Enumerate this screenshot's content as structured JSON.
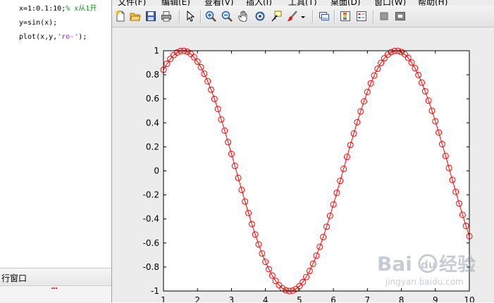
{
  "editor": {
    "lines": [
      {
        "code": "x=1:0.1:10;",
        "comment": "%  x从1开"
      },
      {
        "code": "y=sin(x);"
      },
      {
        "code_pre": "plot(x,y,",
        "string": "'ro-'",
        "code_post": ");"
      }
    ]
  },
  "command_window": {
    "title": "行窗口"
  },
  "figure": {
    "menu": [
      "文件(F)",
      "编辑(E)",
      "查看(V)",
      "插入(I)",
      "工具(T)",
      "桌面(D)",
      "窗口(W)",
      "帮助(H)"
    ],
    "toolbar": [
      "new-figure-icon",
      "open-icon",
      "save-icon",
      "print-icon",
      "select-arrow-icon",
      "zoom-in-icon",
      "zoom-out-icon",
      "pan-hand-icon",
      "rotate-3d-icon",
      "data-cursor-icon",
      "brush-icon",
      "brush-dropdown-icon",
      "link-plot-icon",
      "colorbar-icon",
      "legend-icon",
      "hide-plot-tools-icon",
      "show-plot-tools-icon"
    ]
  },
  "chart_data": {
    "type": "line",
    "title": "",
    "xlabel": "",
    "ylabel": "",
    "xlim": [
      1,
      10
    ],
    "ylim": [
      -1,
      1
    ],
    "xticks": [
      "1",
      "2",
      "3",
      "4",
      "5",
      "6",
      "7",
      "8",
      "9",
      "10"
    ],
    "yticks": [
      "1",
      "0.8",
      "0.6",
      "0.4",
      "0.2",
      "0",
      "-0.2",
      "-0.4",
      "-0.6",
      "-0.8",
      "-1"
    ],
    "grid": false,
    "style": "ro-",
    "color": "#ff0000",
    "series": [
      {
        "function": "sin(x)",
        "x_start": 1,
        "x_step": 0.1,
        "x_end": 10,
        "x": [
          1.0,
          1.1,
          1.2,
          1.3,
          1.4,
          1.5,
          1.6,
          1.7,
          1.8,
          1.9,
          2.0,
          2.1,
          2.2,
          2.3,
          2.4,
          2.5,
          2.6,
          2.7,
          2.8,
          2.9,
          3.0,
          3.1,
          3.2,
          3.3,
          3.4,
          3.5,
          3.6,
          3.7,
          3.8,
          3.9,
          4.0,
          4.1,
          4.2,
          4.3,
          4.4,
          4.5,
          4.6,
          4.7,
          4.8,
          4.9,
          5.0,
          5.1,
          5.2,
          5.3,
          5.4,
          5.5,
          5.6,
          5.7,
          5.8,
          5.9,
          6.0,
          6.1,
          6.2,
          6.3,
          6.4,
          6.5,
          6.6,
          6.7,
          6.8,
          6.9,
          7.0,
          7.1,
          7.2,
          7.3,
          7.4,
          7.5,
          7.6,
          7.7,
          7.8,
          7.9,
          8.0,
          8.1,
          8.2,
          8.3,
          8.4,
          8.5,
          8.6,
          8.7,
          8.8,
          8.9,
          9.0,
          9.1,
          9.2,
          9.3,
          9.4,
          9.5,
          9.6,
          9.7,
          9.8,
          9.9,
          10.0
        ],
        "y": [
          0.8415,
          0.8912,
          0.932,
          0.9636,
          0.9854,
          0.9975,
          0.9996,
          0.9917,
          0.9738,
          0.9463,
          0.9093,
          0.8632,
          0.8085,
          0.7457,
          0.6755,
          0.5985,
          0.5155,
          0.4274,
          0.335,
          0.2392,
          0.1411,
          0.0416,
          -0.0584,
          -0.1577,
          -0.2555,
          -0.3508,
          -0.4425,
          -0.5298,
          -0.6119,
          -0.6878,
          -0.7568,
          -0.8183,
          -0.8716,
          -0.9162,
          -0.9516,
          -0.9775,
          -0.9937,
          -0.9999,
          -0.9962,
          -0.9825,
          -0.9589,
          -0.9258,
          -0.8835,
          -0.8323,
          -0.7728,
          -0.7055,
          -0.6313,
          -0.5507,
          -0.4646,
          -0.3739,
          -0.2794,
          -0.1822,
          -0.0831,
          0.0168,
          0.1165,
          0.2151,
          0.3115,
          0.4048,
          0.494,
          0.5784,
          0.657,
          0.729,
          0.7937,
          0.8504,
          0.8987,
          0.938,
          0.9679,
          0.9882,
          0.9985,
          0.9989,
          0.9894,
          0.9699,
          0.9407,
          0.9022,
          0.8546,
          0.7985,
          0.7344,
          0.663,
          0.585,
          0.501,
          0.4121,
          0.319,
          0.2229,
          0.1245,
          0.0248,
          -0.0752,
          -0.1743,
          -0.2718,
          -0.3665,
          -0.4575,
          -0.544
        ]
      }
    ]
  },
  "watermark": {
    "brand": "Bai",
    "brand_du": "du",
    "cn": "经验",
    "url": "jingyan.baidu.com"
  }
}
